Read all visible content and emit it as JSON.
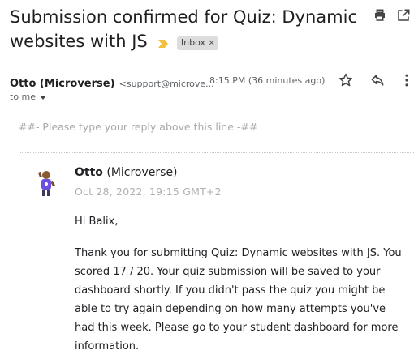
{
  "email": {
    "subject": "Submission confirmed for Quiz: Dynamic websites with JS",
    "label": "Inbox",
    "label_remove": "×",
    "sender_name": "Otto (Microverse)",
    "sender_email": "<support@microve...",
    "time": "8:15 PM (36 minutes ago)",
    "to_me": "to me",
    "reply_hint": "##- Please type your reply above this line -##"
  },
  "message": {
    "sender_bold": "Otto",
    "sender_rest": " (Microverse)",
    "date": "Oct 28, 2022, 19:15 GMT+2",
    "greeting": "Hi Balix,",
    "body": "Thank you for submitting Quiz: Dynamic websites with JS. You scored 17 / 20. Your quiz submission will be saved to your dashboard shortly. If you didn't pass the quiz you might be able to try again depending on how many attempts you've had this week. Please go to your student dashboard for more information."
  },
  "icons": {
    "print": "print-icon",
    "open_new": "open-in-new-window-icon",
    "important": "important-marker-icon",
    "star": "star-icon",
    "reply": "reply-icon",
    "more": "more-vert-icon",
    "avatar": "avatar-icon"
  },
  "colors": {
    "important_marker": "#f2c13b",
    "label_bg": "#dddddd",
    "avatar_shirt": "#6c4ee0"
  }
}
